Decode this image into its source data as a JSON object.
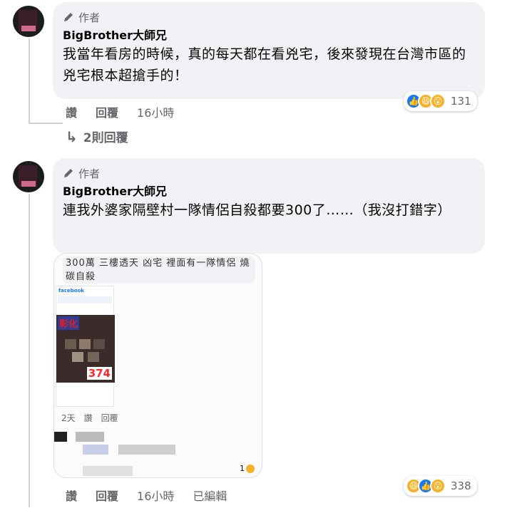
{
  "comment1": {
    "badge": "作者",
    "name": "BigBrother大師兄",
    "text": "我當年看房的時候，真的每天都在看兇宅，後來發現在台灣市區的兇宅根本超搶手的！",
    "reactions": {
      "icons": [
        "like-icon",
        "haha-icon",
        "wow-icon"
      ],
      "count": "131"
    },
    "actions": {
      "like": "讚",
      "reply": "回覆",
      "time": "16小時"
    },
    "replies_label": "2則回覆"
  },
  "comment2": {
    "badge": "作者",
    "name": "BigBrother大師兄",
    "text": "連我外婆家隔壁村一隊情侶自殺都要300了……（我沒打錯字）",
    "attachment": {
      "caption": "300萬 三樓透天 凶宅 裡面有一隊情侶 燒碳自殺",
      "app_name": "facebook",
      "image_title": "彰化",
      "image_price": "374",
      "meta_time": "2天",
      "meta_like": "讚",
      "meta_reply": "回覆",
      "reaction_count": "1"
    },
    "reactions": {
      "icons": [
        "haha-icon",
        "like-icon",
        "wow-icon"
      ],
      "count": "338"
    },
    "actions": {
      "like": "讚",
      "reply": "回覆",
      "time": "16小時",
      "edited": "已編輯"
    }
  },
  "colors": {
    "bubble": "#f0f2f5",
    "secondary_text": "#65676b",
    "like_blue": "#1877f2",
    "emoji_yellow": "#f7b125"
  }
}
